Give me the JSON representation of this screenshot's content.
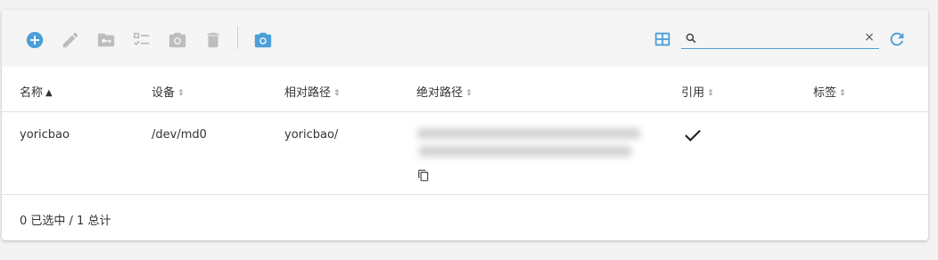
{
  "toolbar": {
    "buttons": [
      {
        "name": "add-button",
        "icon": "plus-circle-icon",
        "color": "#4a9fd8"
      },
      {
        "name": "edit-button",
        "icon": "pencil-icon",
        "color": "#bdbdbd"
      },
      {
        "name": "folder-key-button",
        "icon": "folder-key-icon",
        "color": "#bdbdbd"
      },
      {
        "name": "checklist-button",
        "icon": "checklist-icon",
        "color": "#bdbdbd"
      },
      {
        "name": "camera-button",
        "icon": "camera-icon",
        "color": "#bdbdbd"
      },
      {
        "name": "delete-button",
        "icon": "trash-icon",
        "color": "#bdbdbd"
      },
      {
        "name": "snapshot-button",
        "icon": "camera-icon",
        "color": "#4a9fd8"
      }
    ],
    "view_toggle_icon": "grid-view-icon",
    "refresh_icon": "refresh-icon",
    "search": {
      "value": "",
      "placeholder": "",
      "clear": "×"
    }
  },
  "table": {
    "columns": [
      {
        "label": "名称",
        "sort": "▲"
      },
      {
        "label": "设备",
        "sort": "⇕"
      },
      {
        "label": "相对路径",
        "sort": "⇕"
      },
      {
        "label": "绝对路径",
        "sort": "⇕"
      },
      {
        "label": "引用",
        "sort": "⇕"
      },
      {
        "label": "标签",
        "sort": "⇕"
      }
    ],
    "rows": [
      {
        "name": "yoricbao",
        "device": "/dev/md0",
        "relative_path": "yoricbao/",
        "absolute_path_redacted": true,
        "referenced": true,
        "tags": ""
      }
    ]
  },
  "footer": {
    "summary": "0 已选中 / 1 总计"
  },
  "colors": {
    "accent": "#4a9fd8",
    "disabled": "#bdbdbd",
    "toolbar_bg": "#f5f5f5"
  }
}
